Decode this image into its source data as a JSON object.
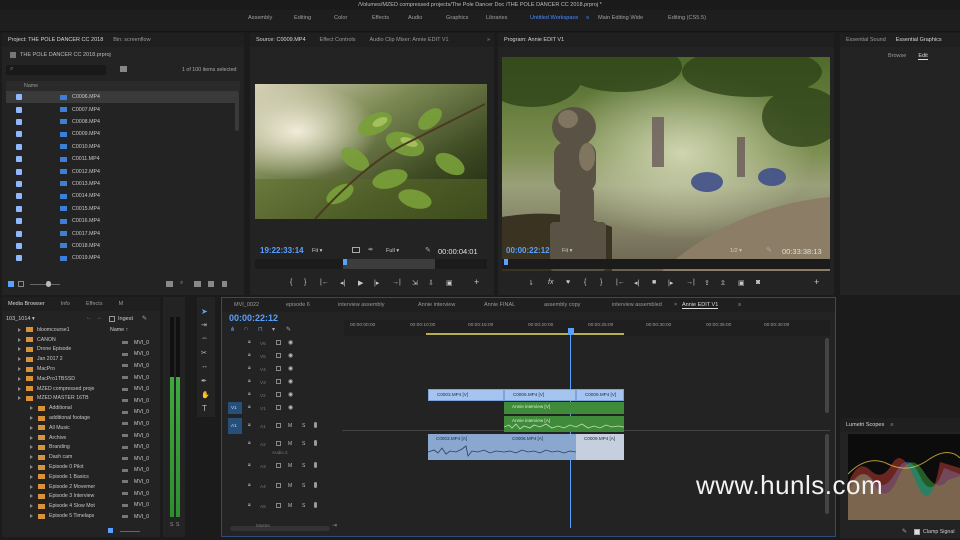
{
  "window_title": "/Volumes/MZED compressed projects/The Pole Dancer Doc /THE POLE DANCER CC 2018.prproj *",
  "workspaces": {
    "items": [
      "Assembly",
      "Editing",
      "Color",
      "Effects",
      "Audio",
      "Graphics",
      "Libraries",
      "Untitled Workspace",
      "Main Editing Wide",
      "Editing (CS5.5)"
    ],
    "active": "Untitled Workspace"
  },
  "project_panel": {
    "tab": "Project: THE POLE DANCER CC 2018",
    "tab2": "Bin: screenflow",
    "project_name": "THE POLE DANCER CC 2018.prproj",
    "selection_info": "1 of 100 items selected",
    "col_name": "Name",
    "items": [
      "C0006.MP4",
      "C0007.MP4",
      "C0008.MP4",
      "C0009.MP4",
      "C0010.MP4",
      "C0011.MP4",
      "C0012.MP4",
      "C0013.MP4",
      "C0014.MP4",
      "C0015.MP4",
      "C0016.MP4",
      "C0017.MP4",
      "C0018.MP4",
      "C0019.MP4"
    ]
  },
  "source_monitor": {
    "tabs": [
      "Source: C0009.MP4",
      "Effect Controls",
      "Audio Clip Mixer: Annie EDIT V1"
    ],
    "timecode": "19:22:33:14",
    "fit": "Fit",
    "quality": "Full",
    "duration": "00:00:04:01"
  },
  "program_monitor": {
    "tab": "Program: Annie EDIT V1",
    "timecode": "00:00:22:12",
    "fit": "Fit",
    "quality": "1/2",
    "duration": "00:33:38:13"
  },
  "right_panel": {
    "tabs": [
      "Essential Sound",
      "Essential Graphics"
    ],
    "subtabs": [
      "Browse",
      "Edit"
    ]
  },
  "media_browser": {
    "tabs": [
      "Media Browser",
      "Info",
      "Effects",
      "M"
    ],
    "path": "103_1014",
    "ingest_label": "Ingest",
    "col_name": "Name",
    "folders": [
      "bloomcourse1",
      "CANON",
      "Drone Episode",
      "Jan 2017 2",
      "MacPro",
      "MacPro1TBSSD",
      "MZED compressed proje",
      "MZED MASTER 16TB",
      "Additional",
      "additional footage",
      "All Music",
      "Archive",
      "Branding",
      "Dash cam",
      "Episode 0 Pilot",
      "Episode 1 Basics",
      "Episode 2 Movemer",
      "Episode 3 Interview",
      "Episode 4 Slow Mot",
      "Episode 5 Timelaps"
    ],
    "files": [
      "MVI_0",
      "MVI_0",
      "MVI_0",
      "MVI_0",
      "MVI_0",
      "MVI_0",
      "MVI_0",
      "MVI_0",
      "MVI_0",
      "MVI_0",
      "MVI_0",
      "MVI_0",
      "MVI_0",
      "MVI_0",
      "MVI_0",
      "MVI_0"
    ],
    "meter_labels": [
      "S",
      "S"
    ]
  },
  "timeline": {
    "tabs": [
      "MVI_0022",
      "episode 6",
      "interview assembly",
      "Annie interview",
      "Annie FINAL",
      "assembly copy",
      "interview assembled",
      "Annie EDIT V1"
    ],
    "active_tab": "Annie EDIT V1",
    "timecode": "00:00:22:12",
    "ruler": [
      "00:00:00:00",
      "00:00:10:00",
      "00:00:15:00",
      "00:00:20:00",
      "00:00:25:00",
      "00:00:30:00",
      "00:00:35:00",
      "00:00:40:00"
    ],
    "video_tracks": [
      "V6",
      "V5",
      "V4",
      "V3",
      "V2",
      "V1"
    ],
    "audio_tracks": [
      "A1",
      "A2",
      "A3",
      "A4",
      "A5"
    ],
    "audio2_name": "Audio 2",
    "track_src": [
      "V1",
      "A1"
    ],
    "track_btns": [
      "M",
      "S"
    ],
    "clips": {
      "v2_a": "C0003.MP4 [V]",
      "v2_b": "C0006.MP4 [V]",
      "v2_c": "C0009.MP4 [V]",
      "v1": "Annie interview [V]",
      "a1": "Annie interview [A]",
      "a2_a": "C0003.MP4 [A]",
      "a2_b": "C0006.MP4 [A]",
      "a2_c": "C0009.MP4 [A]"
    },
    "bottom_label": "Master"
  },
  "lumetri": {
    "title": "Lumetri Scopes",
    "clamp": "Clamp Signal"
  },
  "watermark": "www.hunls.com"
}
